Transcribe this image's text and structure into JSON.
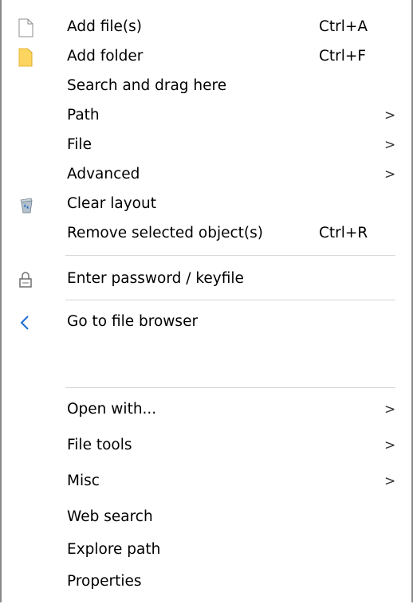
{
  "menu": {
    "add_files": {
      "label": "Add file(s)",
      "shortcut": "Ctrl+A",
      "icon": "file-icon"
    },
    "add_folder": {
      "label": "Add folder",
      "shortcut": "Ctrl+F",
      "icon": "folder-icon"
    },
    "search_drag": {
      "label": "Search and drag here"
    },
    "path": {
      "label": "Path",
      "arrow": ">"
    },
    "file": {
      "label": "File",
      "arrow": ">"
    },
    "advanced": {
      "label": "Advanced",
      "arrow": ">"
    },
    "clear_layout": {
      "label": "Clear layout",
      "icon": "recycle-bin-icon"
    },
    "remove_selected": {
      "label": "Remove selected object(s)",
      "shortcut": "Ctrl+R"
    },
    "enter_password": {
      "label": "Enter password / keyfile",
      "icon": "lock-icon"
    },
    "go_file_browser": {
      "label": "Go to file browser",
      "icon": "chevron-left-icon"
    },
    "open_with": {
      "label": "Open with...",
      "arrow": ">"
    },
    "file_tools": {
      "label": "File tools",
      "arrow": ">"
    },
    "misc": {
      "label": "Misc",
      "arrow": ">"
    },
    "web_search": {
      "label": "Web search"
    },
    "explore_path": {
      "label": "Explore path"
    },
    "properties": {
      "label": "Properties"
    }
  },
  "colors": {
    "folder": "#fcd560",
    "chevron": "#1a6dd4",
    "separator": "#d8d8d8",
    "border": "#8a8a8a"
  }
}
